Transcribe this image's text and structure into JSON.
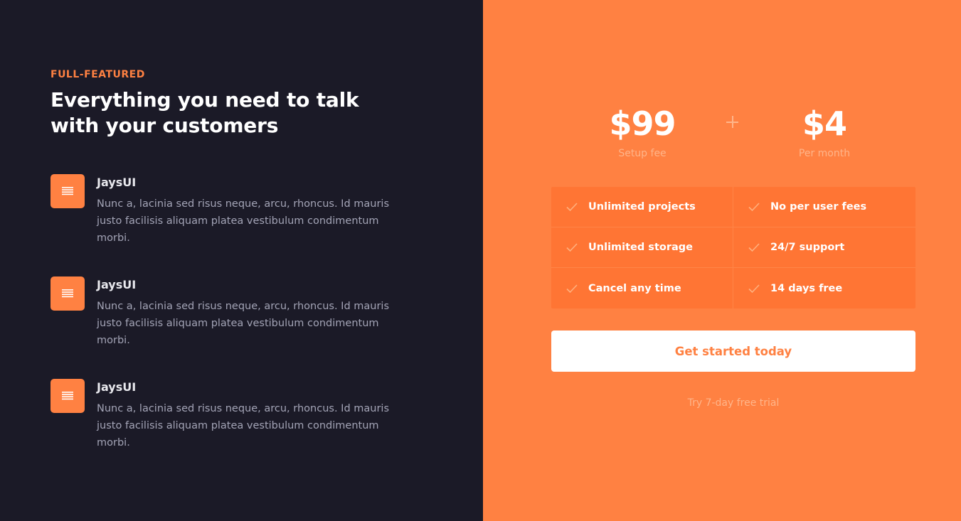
{
  "intro": {
    "eyebrow": "FULL-FEATURED",
    "headline": "Everything you need to talk with your customers"
  },
  "features": [
    {
      "icon": "menu-lines-icon",
      "title": "JaysUI",
      "description": "Nunc a, lacinia sed risus neque, arcu, rhoncus. Id mauris justo facilisis aliquam platea vestibulum condimentum morbi."
    },
    {
      "icon": "menu-lines-icon",
      "title": "JaysUI",
      "description": "Nunc a, lacinia sed risus neque, arcu, rhoncus. Id mauris justo facilisis aliquam platea vestibulum condimentum morbi."
    },
    {
      "icon": "menu-lines-icon",
      "title": "JaysUI",
      "description": "Nunc a, lacinia sed risus neque, arcu, rhoncus. Id mauris justo facilisis aliquam platea vestibulum condimentum morbi."
    }
  ],
  "pricing": {
    "setup": {
      "amount": "$99",
      "label": "Setup fee"
    },
    "monthly": {
      "amount": "$4",
      "label": "Per month"
    },
    "separator_icon": "plus-icon",
    "perks": [
      "Unlimited projects",
      "No per user fees",
      "Unlimited storage",
      "24/7 support",
      "Cancel any time",
      "14 days free"
    ],
    "perk_icon": "check-icon",
    "cta_label": "Get started today",
    "trial_text": "Try 7-day free trial"
  },
  "colors": {
    "dark_background": "#1b1a27",
    "accent": "#ff8142",
    "perk_panel": "#ff7534",
    "muted_text": "#a3a4b6"
  }
}
